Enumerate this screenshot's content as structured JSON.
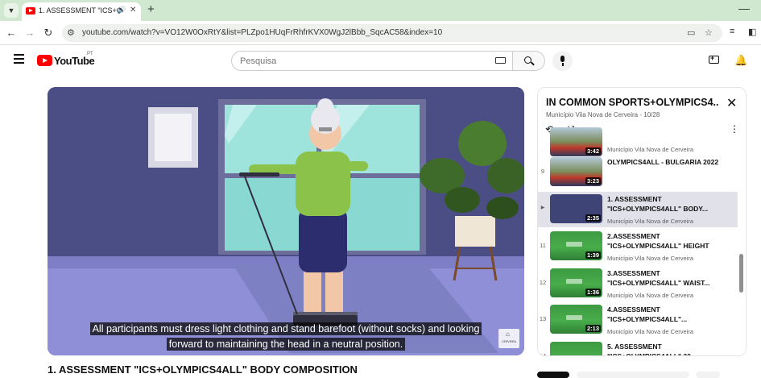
{
  "browser": {
    "tab_title": "1. ASSESSMENT \"ICS+OLYMPICS4ALL\" BODY COMPOSITION",
    "url": "youtube.com/watch?v=VO12W0OxRtY&list=PLZpo1HUqFrRhfrKVX0WgJ2lBbb_SqcAC58&index=10"
  },
  "header": {
    "logo_text": "YouTube",
    "logo_country": "PT",
    "search_placeholder": "Pesquisa"
  },
  "video": {
    "subtitle_line1": "All participants must dress light clothing and stand barefoot (without socks) and looking",
    "subtitle_line2": "forward to maintaining the head in a neutral position.",
    "watermark_text": "CERVEIRA",
    "title": "1. ASSESSMENT \"ICS+OLYMPICS4ALL\" BODY COMPOSITION"
  },
  "playlist": {
    "title": "IN COMMON SPORTS+OLYMPICS4...",
    "channel": "Município Vila Nova de Cerveira",
    "position": "10/28",
    "items": [
      {
        "index": "",
        "duration": "3:42",
        "title": "",
        "channel": "Município Vila Nova de Cerveira"
      },
      {
        "index": "9",
        "duration": "3:23",
        "title": "OLYMPICS4ALL - BULGARIA 2022",
        "channel": "Município Vila Nova de Cerveira"
      },
      {
        "index": "▶",
        "duration": "2:35",
        "title": "1. ASSESSMENT \"ICS+OLYMPICS4ALL\" BODY...",
        "channel": "Município Vila Nova de Cerveira"
      },
      {
        "index": "11",
        "duration": "1:39",
        "title": "2.ASSESSMENT \"ICS+OLYMPICS4ALL\" HEIGHT",
        "channel": "Município Vila Nova de Cerveira"
      },
      {
        "index": "12",
        "duration": "1:36",
        "title": "3.ASSESSMENT \"ICS+OLYMPICS4ALL\" WAIST...",
        "channel": "Município Vila Nova de Cerveira"
      },
      {
        "index": "13",
        "duration": "2:13",
        "title": "4.ASSESSMENT \"ICS+OLYMPICS4ALL\"...",
        "channel": "Município Vila Nova de Cerveira"
      },
      {
        "index": "14",
        "duration": "",
        "title": "5. ASSESSMENT \"ICS+OLYMPICS4ALL\" 30...",
        "channel": ""
      }
    ]
  }
}
